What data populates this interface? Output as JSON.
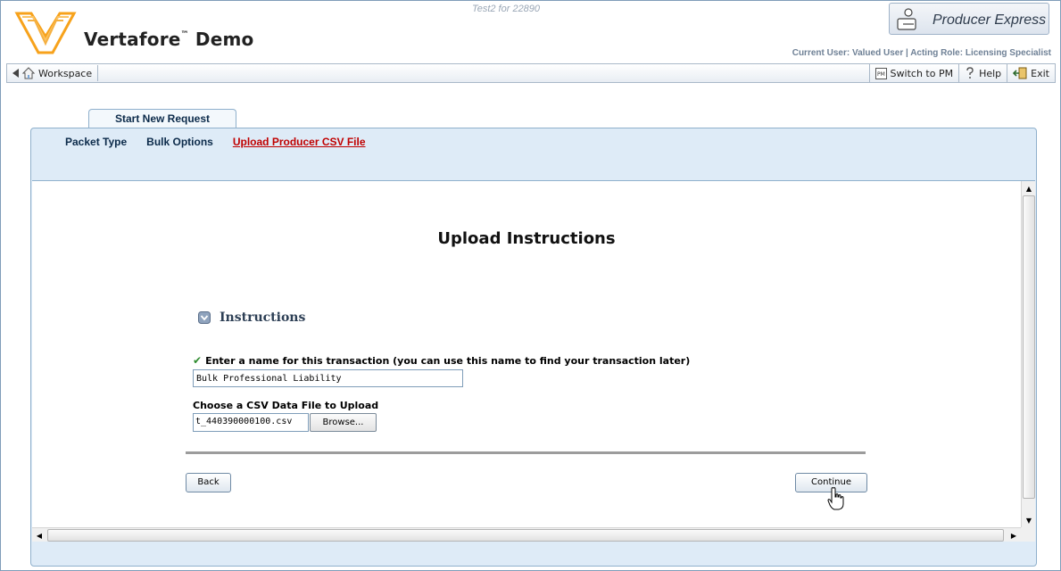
{
  "header": {
    "brand": "Vertafore",
    "brand_tm": "™",
    "brand_suffix": "Demo",
    "env_title": "Test2 for 22890",
    "product_name": "Producer Express",
    "user_line": "Current User: Valued User  |  Acting Role: Licensing Specialist",
    "logo_icon": "vertafore-logo",
    "product_icon": "producer-express-icon"
  },
  "toolbar": {
    "back_icon": "back-arrow-icon",
    "home_icon": "home-icon",
    "workspace_label": "Workspace",
    "switch_label": "Switch to PM",
    "switch_icon": "pm-icon",
    "help_label": "Help",
    "help_icon": "help-icon",
    "exit_label": "Exit",
    "exit_icon": "exit-icon"
  },
  "tab": {
    "label": "Start New Request"
  },
  "steps": [
    {
      "label": "Packet Type",
      "active": false
    },
    {
      "label": "Bulk Options",
      "active": false
    },
    {
      "label": "Upload Producer CSV File",
      "active": true
    }
  ],
  "main": {
    "title": "Upload Instructions",
    "section_title": "Instructions",
    "name_label": "Enter a name for this transaction (you can use this name to find your transaction later)",
    "name_value": "Bulk Professional Liability",
    "file_label": "Choose a CSV Data File to Upload",
    "file_value": "t_440390000100.csv",
    "browse_label": "Browse...",
    "back_label": "Back",
    "continue_label": "Continue"
  },
  "colors": {
    "accent_red": "#c00000",
    "panel_bg": "#deebf7",
    "logo_orange": "#f7a21b"
  }
}
